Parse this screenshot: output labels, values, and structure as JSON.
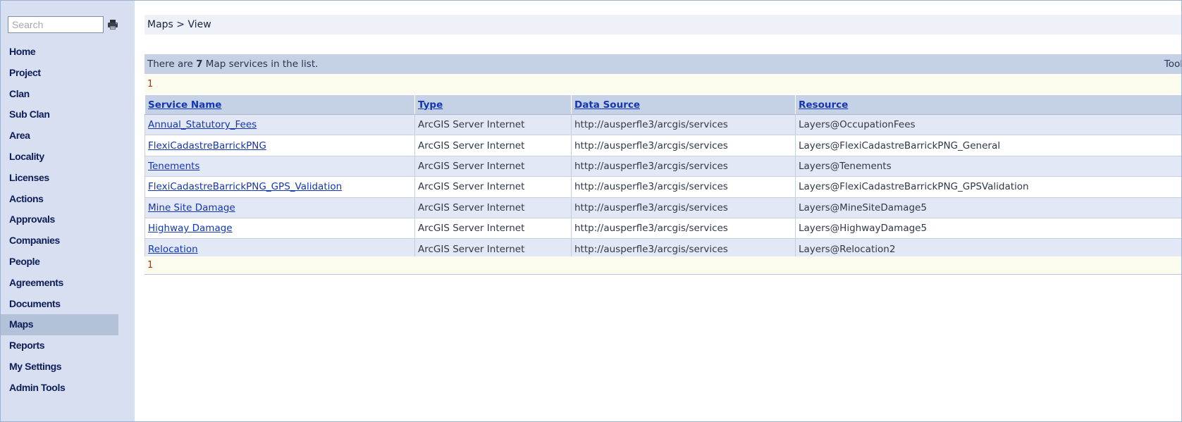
{
  "sidebar": {
    "search_placeholder": "Search",
    "search_icon": "printer-icon",
    "items": [
      {
        "label": "Home",
        "active": false
      },
      {
        "label": "Project",
        "active": false
      },
      {
        "label": "Clan",
        "active": false
      },
      {
        "label": "Sub Clan",
        "active": false
      },
      {
        "label": "Area",
        "active": false
      },
      {
        "label": "Locality",
        "active": false
      },
      {
        "label": "Licenses",
        "active": false
      },
      {
        "label": "Actions",
        "active": false
      },
      {
        "label": "Approvals",
        "active": false
      },
      {
        "label": "Companies",
        "active": false
      },
      {
        "label": "People",
        "active": false
      },
      {
        "label": "Agreements",
        "active": false
      },
      {
        "label": "Documents",
        "active": false
      },
      {
        "label": "Maps",
        "active": true
      },
      {
        "label": "Reports",
        "active": false
      },
      {
        "label": "My Settings",
        "active": false
      },
      {
        "label": "Admin Tools",
        "active": false
      }
    ]
  },
  "main": {
    "breadcrumb": "Maps > View",
    "summary": {
      "prefix": "There are ",
      "count": "7",
      "suffix": " Map services in the list."
    },
    "tools_label": "Tool",
    "pager_top": "1",
    "pager_bottom": "1",
    "columns": [
      "Service Name",
      "Type",
      "Data Source",
      "Resource"
    ],
    "rows": [
      {
        "name": "Annual_Statutory_Fees",
        "type": "ArcGIS Server Internet",
        "source": "http://ausperfle3/arcgis/services",
        "resource": "Layers@OccupationFees"
      },
      {
        "name": "FlexiCadastreBarrickPNG",
        "type": "ArcGIS Server Internet",
        "source": "http://ausperfle3/arcgis/services",
        "resource": "Layers@FlexiCadastreBarrickPNG_General"
      },
      {
        "name": "Tenements",
        "type": "ArcGIS Server Internet",
        "source": "http://ausperfle3/arcgis/services",
        "resource": "Layers@Tenements"
      },
      {
        "name": "FlexiCadastreBarrickPNG_GPS_Validation",
        "type": "ArcGIS Server Internet",
        "source": "http://ausperfle3/arcgis/services",
        "resource": "Layers@FlexiCadastreBarrickPNG_GPSValidation"
      },
      {
        "name": "Mine Site Damage",
        "type": "ArcGIS Server Internet",
        "source": "http://ausperfle3/arcgis/services",
        "resource": "Layers@MineSiteDamage5"
      },
      {
        "name": "Highway Damage",
        "type": "ArcGIS Server Internet",
        "source": "http://ausperfle3/arcgis/services",
        "resource": "Layers@HighwayDamage5"
      },
      {
        "name": "Relocation",
        "type": "ArcGIS Server Internet",
        "source": "http://ausperfle3/arcgis/services",
        "resource": "Layers@Relocation2"
      }
    ]
  },
  "colors": {
    "sidebar_bg": "#d7dff0",
    "active_bg": "#b3c2d9",
    "nav_text": "#0c1d57",
    "header_bg": "#c5d1e4",
    "link": "#1236b4",
    "pager_number": "#c02a00"
  }
}
